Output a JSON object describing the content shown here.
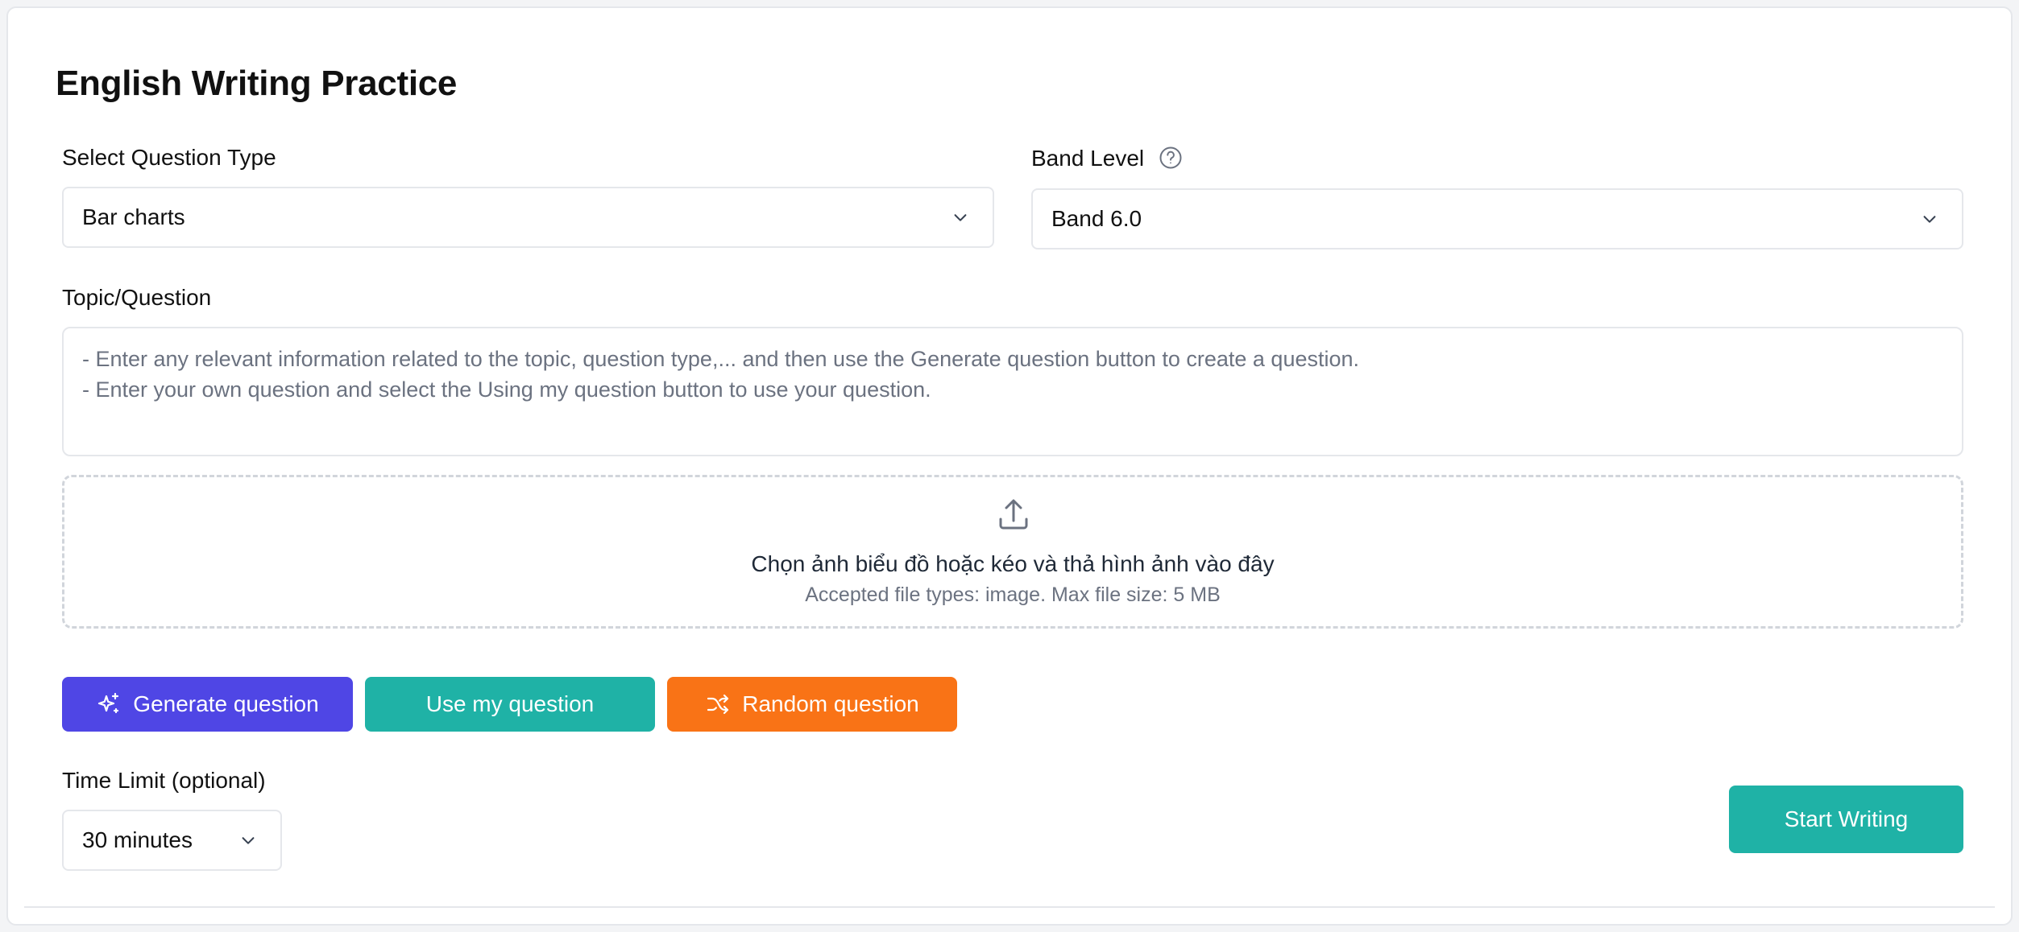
{
  "page": {
    "title": "English Writing Practice"
  },
  "question_type": {
    "label": "Select Question Type",
    "selected": "Bar charts"
  },
  "band_level": {
    "label": "Band Level",
    "selected": "Band 6.0",
    "help_icon": "question-circle-icon"
  },
  "topic": {
    "label": "Topic/Question",
    "value": "",
    "placeholder_lines": [
      "- Enter any relevant information related to the topic, question type,... and then use the Generate question button to create a question.",
      "- Enter your own question and select the Using my question button to use your question."
    ]
  },
  "upload": {
    "icon": "upload-icon",
    "title": "Chọn ảnh biểu đồ hoặc kéo và thả hình ảnh vào đây",
    "subtitle": "Accepted file types: image. Max file size: 5 MB"
  },
  "actions": {
    "generate": {
      "label": "Generate question",
      "icon": "sparkles-icon",
      "color": "#4f46e5"
    },
    "use_mine": {
      "label": "Use my question",
      "color": "#1fb2a6"
    },
    "random": {
      "label": "Random question",
      "icon": "shuffle-icon",
      "color": "#f97316"
    }
  },
  "time_limit": {
    "label": "Time Limit (optional)",
    "selected": "30 minutes"
  },
  "start": {
    "label": "Start Writing",
    "color": "#1fb2a6"
  }
}
